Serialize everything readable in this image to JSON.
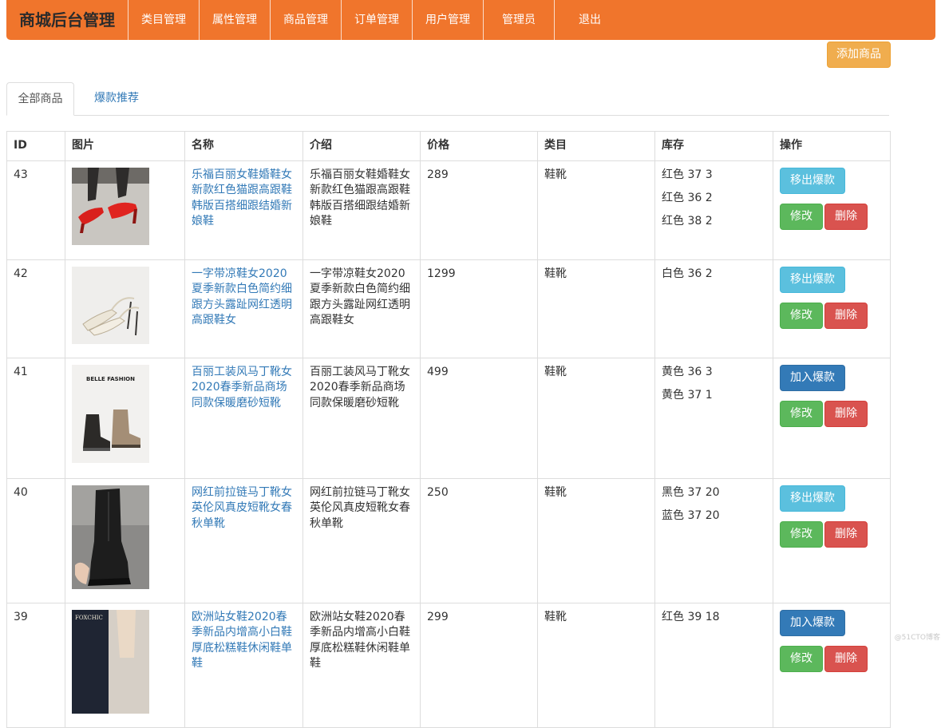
{
  "navbar": {
    "brand": "商城后台管理",
    "items": [
      "类目管理",
      "属性管理",
      "商品管理",
      "订单管理",
      "用户管理",
      "管理员",
      "退出"
    ],
    "color": "#f0752c"
  },
  "toolbar": {
    "add_label": "添加商品"
  },
  "tabs": [
    {
      "label": "全部商品",
      "active": true
    },
    {
      "label": "爆款推荐",
      "active": false
    }
  ],
  "table": {
    "headers": [
      "ID",
      "图片",
      "名称",
      "介绍",
      "价格",
      "类目",
      "库存",
      "操作"
    ],
    "edit_label": "修改",
    "delete_label": "删除",
    "rows": [
      {
        "id": "43",
        "name": "乐福百丽女鞋婚鞋女新款红色猫跟高跟鞋韩版百搭细跟结婚新娘鞋",
        "intro": "乐福百丽女鞋婚鞋女新款红色猫跟高跟鞋韩版百搭细跟结婚新娘鞋",
        "price": "289",
        "category": "鞋靴",
        "stock": [
          "红色 37 3",
          "红色 36 2",
          "红色 38 2"
        ],
        "hot_label": "移出爆款",
        "hot_state": "remove",
        "image": "red-heels-photo"
      },
      {
        "id": "42",
        "name": "一字带凉鞋女2020夏季新款白色简约细跟方头露趾网红透明高跟鞋女",
        "intro": "一字带凉鞋女2020夏季新款白色简约细跟方头露趾网红透明高跟鞋女",
        "price": "1299",
        "category": "鞋靴",
        "stock": [
          "白色 36 2"
        ],
        "hot_label": "移出爆款",
        "hot_state": "remove",
        "image": "white-sandals-photo"
      },
      {
        "id": "41",
        "name": "百丽工装风马丁靴女2020春季新品商场同款保暖磨砂短靴",
        "intro": "百丽工装风马丁靴女2020春季新品商场同款保暖磨砂短靴",
        "price": "499",
        "category": "鞋靴",
        "stock": [
          "黄色 36 3",
          "黄色 37 1"
        ],
        "hot_label": "加入爆款",
        "hot_state": "add",
        "image": "martin-boots-photo",
        "image_text": "BELLE FASHION"
      },
      {
        "id": "40",
        "name": "网红前拉链马丁靴女英伦风真皮短靴女春秋单靴",
        "intro": "网红前拉链马丁靴女英伦风真皮短靴女春秋单靴",
        "price": "250",
        "category": "鞋靴",
        "stock": [
          "黑色 37 20",
          "蓝色 37 20"
        ],
        "hot_label": "移出爆款",
        "hot_state": "remove",
        "image": "black-zip-boots-photo"
      },
      {
        "id": "39",
        "name": "欧洲站女鞋2020春季新品内增高小白鞋厚底松糕鞋休闲鞋单鞋",
        "intro": "欧洲站女鞋2020春季新品内增高小白鞋厚底松糕鞋休闲鞋单鞋",
        "price": "299",
        "category": "鞋靴",
        "stock": [
          "红色 39 18"
        ],
        "hot_label": "加入爆款",
        "hot_state": "add",
        "image": "white-sneakers-photo",
        "image_text": "FOXCHIC"
      }
    ]
  },
  "watermark": "@51CTO博客"
}
